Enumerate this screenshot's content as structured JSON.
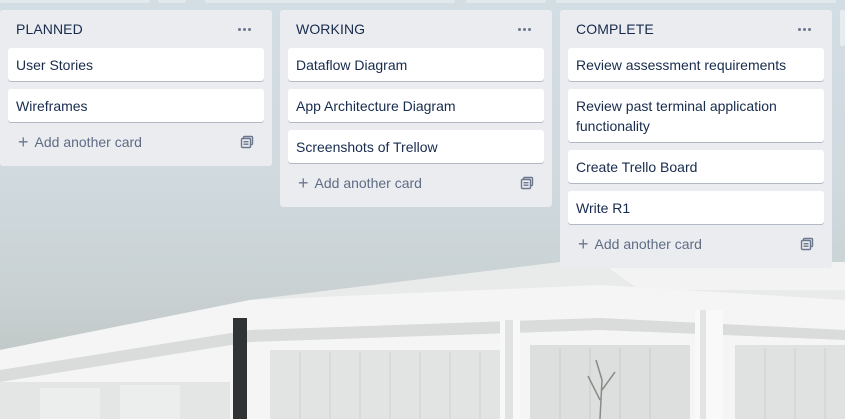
{
  "lists": [
    {
      "title": "PLANNED",
      "cards": [
        "User Stories",
        "Wireframes"
      ],
      "add_label": "Add another card"
    },
    {
      "title": "WORKING",
      "cards": [
        "Dataflow Diagram",
        "App Architecture Diagram",
        "Screenshots of Trellow"
      ],
      "add_label": "Add another card"
    },
    {
      "title": "COMPLETE",
      "cards": [
        "Review assessment requirements",
        "Review past terminal application functionality",
        "Create Trello Board",
        "Write R1"
      ],
      "add_label": "Add another card"
    }
  ],
  "colors": {
    "list_bg": "#ebecf0",
    "card_bg": "#ffffff",
    "text": "#172b4d",
    "muted": "#5e6c84"
  }
}
